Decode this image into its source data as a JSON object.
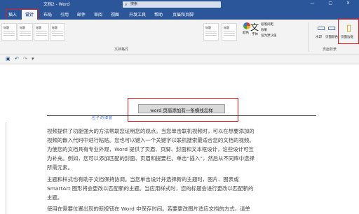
{
  "title_bar": {
    "doc_title": "文档2 - Word",
    "search_placeholder": "搜索",
    "window_controls": "— ▢ ✕"
  },
  "tabs": [
    "插入",
    "设计",
    "布局",
    "引用",
    "邮件",
    "审阅",
    "视图",
    "开发工具",
    "帮助",
    "页眉和页脚"
  ],
  "active_tab": "设计",
  "ribbon": {
    "style_thumbs": [
      "标题",
      "标题",
      "标题",
      "标题",
      "标题",
      "标题"
    ],
    "groups": {
      "document_format": "文档格式",
      "page_background": "页面背景"
    },
    "colors_label": "颜色",
    "fonts_label": "字体",
    "paragraph_spacing": "段落间距",
    "effects": "效果",
    "set_default": "设为默认值",
    "watermark": "水印",
    "page_color": "页面颜色",
    "page_border": "页面边框"
  },
  "document": {
    "header_text": "word 页眉添加有一条横线怎样",
    "header_decoration": "包子的博客",
    "body_lines": [
      "视频提供了功能强大的方法帮助您证明您的观点。当您单击联机视频时，可以在想要添加的",
      "视频的嵌入代码中进行粘贴。您也可以键入一个关键字以联机搜索最适合您的文档的视频。",
      "为使您的文档具有专业外观，Word 提供了页眉、页脚、封面和文本框设计，这些设计可互",
      "为补充。例如，您可以添加匹配的封面、页眉和提要栏。单击“插入”，然后从不同库中选择",
      "所需元素。",
      "主题和样式也有助于文档保持协调。当您单击设计并选择新的主题时，图片、图表或",
      "SmartArt 图形将会更改以匹配新的主题。当应用样式时，您的标题会进行更改以匹配新的",
      "主题。",
      "使用在需要位置出现的新按钮在 Word 中保存时间。若要更改图片适应文档的方式，请单"
    ]
  },
  "colors": {
    "accent": "#2b579a",
    "highlight_box": "#e01b1b"
  }
}
